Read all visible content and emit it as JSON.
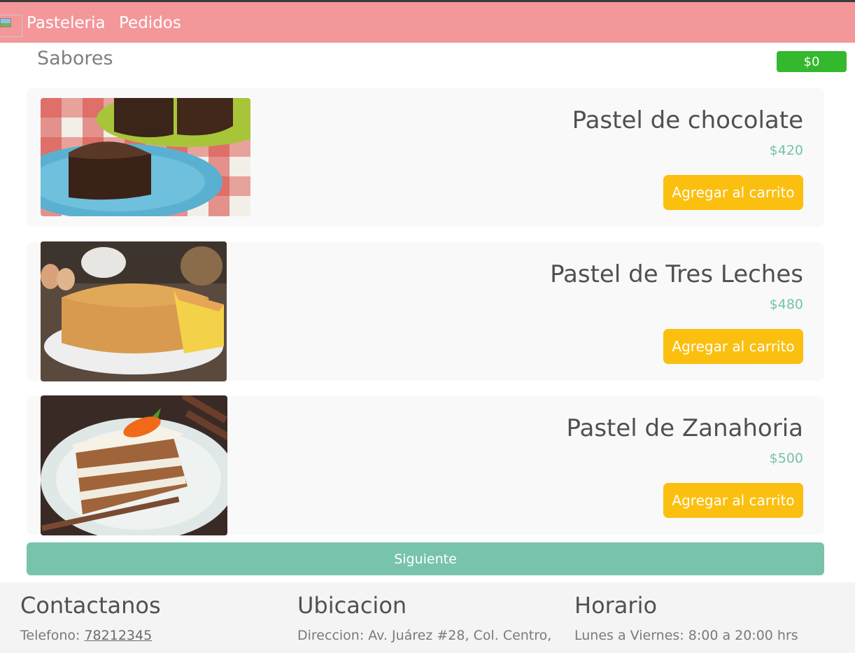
{
  "nav": {
    "brand": "Pasteleria",
    "pedidos": "Pedidos",
    "bg_color": "#f4979a"
  },
  "section": {
    "title": "Sabores"
  },
  "cart": {
    "total": "$0",
    "color": "#34b82e"
  },
  "products": [
    {
      "name": "Pastel de chocolate",
      "price": "$420",
      "button": "Agregar al carrito",
      "image": "chocolate-cake-image"
    },
    {
      "name": "Pastel de Tres Leches",
      "price": "$480",
      "button": "Agregar al carrito",
      "image": "tres-leches-cake-image"
    },
    {
      "name": "Pastel de Zanahoria",
      "price": "$500",
      "button": "Agregar al carrito",
      "image": "carrot-cake-image"
    }
  ],
  "next_button": "Siguiente",
  "footer": {
    "contact": {
      "title": "Contactanos",
      "phone_label": "Telefono: ",
      "phone": "78212345"
    },
    "location": {
      "title": "Ubicacion",
      "address": "Direccion: Av. Juárez #28, Col. Centro,"
    },
    "hours": {
      "title": "Horario",
      "text": "Lunes a Viernes: 8:00 a 20:00 hrs"
    }
  },
  "colors": {
    "button_yellow": "#fbbf0f",
    "price_teal": "#76c1ad",
    "next_teal": "#78c3ac"
  }
}
